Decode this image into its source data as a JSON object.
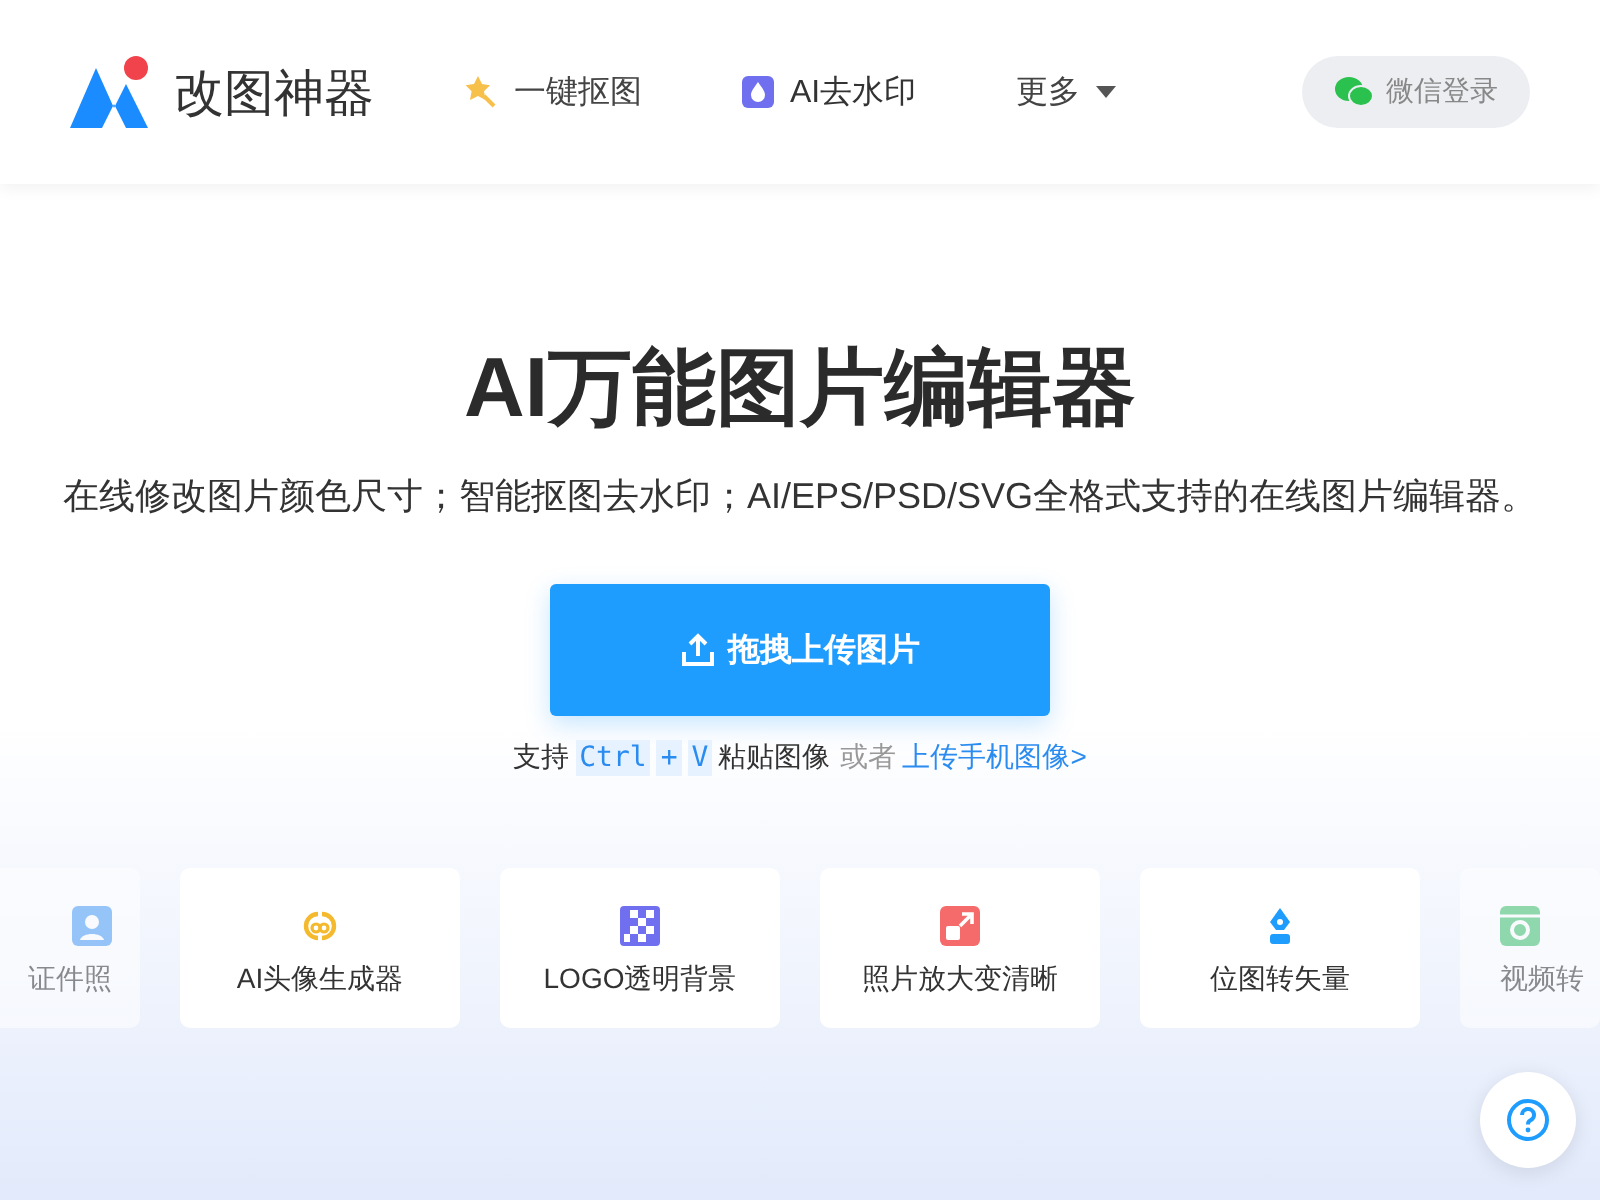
{
  "header": {
    "brand": "改图神器",
    "nav": [
      {
        "kind": "cutout",
        "label": "一键抠图"
      },
      {
        "kind": "watermark",
        "label": "AI去水印"
      },
      {
        "kind": "more",
        "label": "更多"
      }
    ],
    "login_button": "微信登录"
  },
  "hero": {
    "title": "AI万能图片编辑器",
    "subtitle": "在线修改图片颜色尺寸；智能抠图去水印；AI/EPS/PSD/SVG全格式支持的在线图片编辑器。",
    "upload_button": "拖拽上传图片",
    "hint": {
      "prefix": "支持",
      "key_1": "Ctrl",
      "plus": "+",
      "key_2": "V",
      "suffix": "粘贴图像",
      "or": "或者",
      "link": "上传手机图像>"
    }
  },
  "tools": [
    {
      "kind": "id-photo",
      "label": "证件照",
      "faded": true
    },
    {
      "kind": "avatar",
      "label": "AI头像生成器",
      "faded": false
    },
    {
      "kind": "logo",
      "label": "LOGO透明背景",
      "faded": false
    },
    {
      "kind": "enlarge",
      "label": "照片放大变清晰",
      "faded": false
    },
    {
      "kind": "vector",
      "label": "位图转矢量",
      "faded": false
    },
    {
      "kind": "video",
      "label": "视频转",
      "faded": true
    }
  ]
}
